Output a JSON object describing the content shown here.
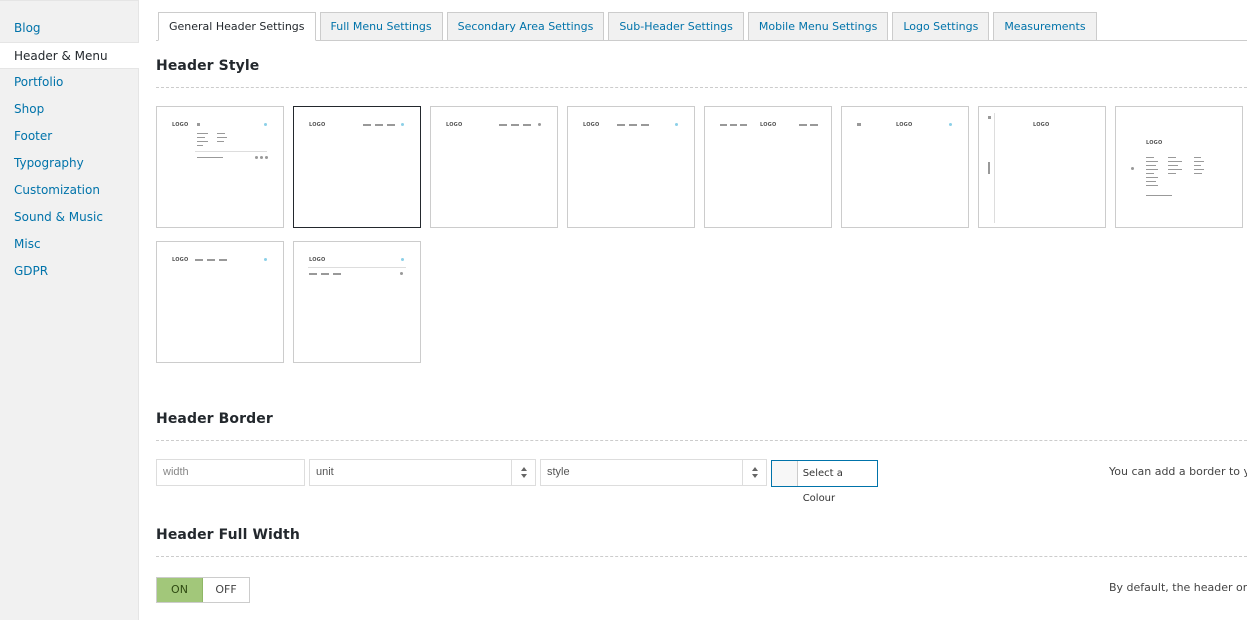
{
  "sidebar": {
    "items": [
      {
        "label": "Blog"
      },
      {
        "label": "Header & Menu",
        "active": true
      },
      {
        "label": "Portfolio"
      },
      {
        "label": "Shop"
      },
      {
        "label": "Footer"
      },
      {
        "label": "Typography"
      },
      {
        "label": "Customization"
      },
      {
        "label": "Sound & Music"
      },
      {
        "label": "Misc"
      },
      {
        "label": "GDPR"
      }
    ]
  },
  "tabs": [
    {
      "label": "General Header Settings",
      "active": true
    },
    {
      "label": "Full Menu Settings"
    },
    {
      "label": "Secondary Area Settings"
    },
    {
      "label": "Sub-Header Settings"
    },
    {
      "label": "Mobile Menu Settings"
    },
    {
      "label": "Logo Settings"
    },
    {
      "label": "Measurements"
    }
  ],
  "header_style": {
    "title": "Header Style",
    "logo_text": "LOGO",
    "selected_index": 1
  },
  "header_border": {
    "title": "Header Border",
    "width_placeholder": "width",
    "unit_value": "unit",
    "style_value": "style",
    "color_button": "Select a Colour",
    "description": "You can add a border to yo"
  },
  "header_full_width": {
    "title": "Header Full Width",
    "on_label": "ON",
    "off_label": "OFF",
    "value": "ON",
    "description": "By default, the header on n"
  },
  "colors": {
    "link": "#0073aa",
    "toggle_on": "#a2c77a",
    "accent_dot": "#8cd0e8"
  }
}
